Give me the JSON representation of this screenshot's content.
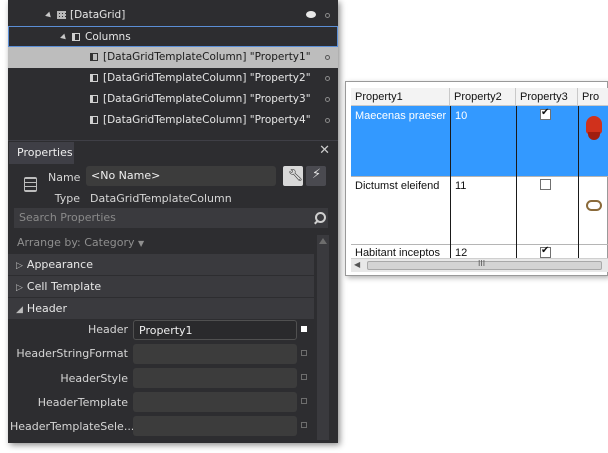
{
  "tree": {
    "datagrid_label": "[DataGrid]",
    "columns_label": "Columns",
    "items": [
      "[DataGridTemplateColumn] \"Property1\"",
      "[DataGridTemplateColumn] \"Property2\"",
      "[DataGridTemplateColumn] \"Property3\"",
      "[DataGridTemplateColumn] \"Property4\""
    ]
  },
  "properties": {
    "title": "Properties",
    "name_label": "Name",
    "name_value": "<No Name>",
    "type_label": "Type",
    "type_value": "DataGridTemplateColumn",
    "search_placeholder": "Search Properties",
    "arrange_label": "Arrange by: Category",
    "sections": [
      "Appearance",
      "Cell Template",
      "Header"
    ],
    "header_props": [
      {
        "label": "Header",
        "value": "Property1"
      },
      {
        "label": "HeaderStringFormat",
        "value": ""
      },
      {
        "label": "HeaderStyle",
        "value": ""
      },
      {
        "label": "HeaderTemplate",
        "value": ""
      },
      {
        "label": "HeaderTemplateSele...",
        "value": ""
      }
    ]
  },
  "grid": {
    "headers": [
      "Property1",
      "Property2",
      "Property3",
      "Pro"
    ],
    "rows": [
      {
        "p1": "Maecenas praeser",
        "p2": "10",
        "checked": true
      },
      {
        "p1": "Dictumst eleifend",
        "p2": "11",
        "checked": false
      },
      {
        "p1": "Habitant inceptos",
        "p2": "12",
        "checked": true
      }
    ],
    "scroll_grip": "III"
  },
  "colors": {
    "panel_bg": "#2d2d30",
    "selected_row": "#bdbdbd",
    "grid_selection": "#3399ff"
  }
}
